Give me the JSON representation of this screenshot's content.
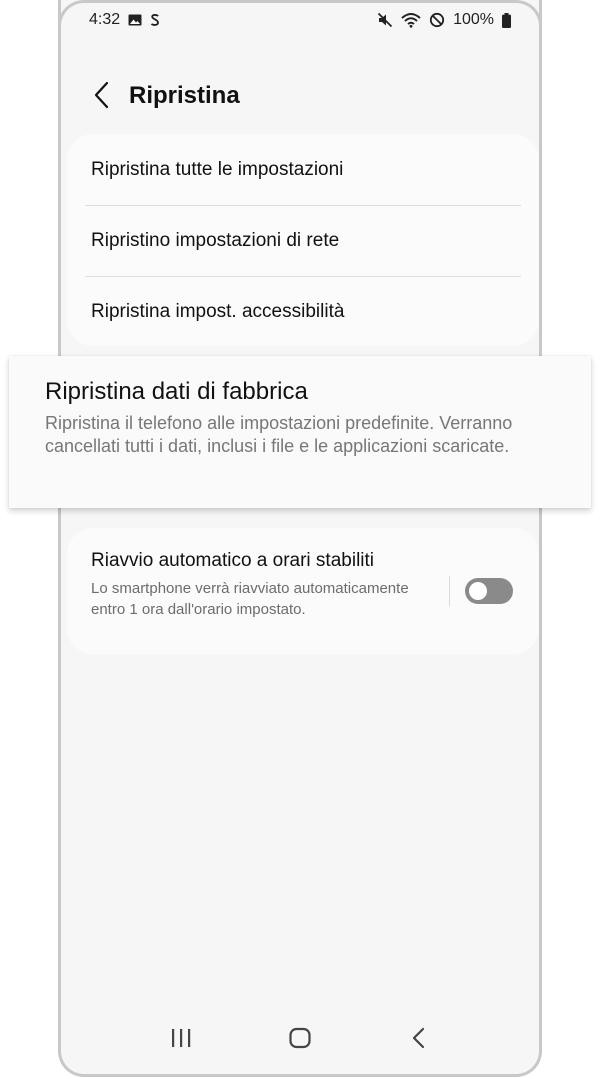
{
  "status_bar": {
    "time": "4:32",
    "battery_text": "100%",
    "icons": [
      "gallery-icon",
      "s-icon",
      "mute-icon",
      "wifi-icon",
      "do-not-disturb-icon",
      "battery-icon"
    ]
  },
  "header": {
    "title": "Ripristina",
    "back_icon": "chevron-left-icon"
  },
  "reset_options": [
    {
      "label": "Ripristina tutte le impostazioni"
    },
    {
      "label": "Ripristino impostazioni di rete"
    },
    {
      "label": "Ripristina impost. accessibilità"
    }
  ],
  "factory_reset": {
    "title": "Ripristina dati di fabbrica",
    "description": "Ripristina il telefono alle impostazioni predefinite. Verranno cancellati tutti i dati, inclusi i file e le applicazioni scaricate."
  },
  "auto_restart": {
    "title": "Riavvio automatico a orari stabiliti",
    "description": "Lo smartphone verrà riavviato automaticamente entro 1 ora dall'orario impostato.",
    "enabled": false
  },
  "nav_bar": {
    "icons": [
      "recents-icon",
      "home-icon",
      "back-icon"
    ]
  },
  "colors": {
    "background": "#f6f6f6",
    "card": "#fbfbfb",
    "toggle_off": "#8a8a8a",
    "text_primary": "#111111",
    "text_secondary": "#6c6c6c"
  }
}
